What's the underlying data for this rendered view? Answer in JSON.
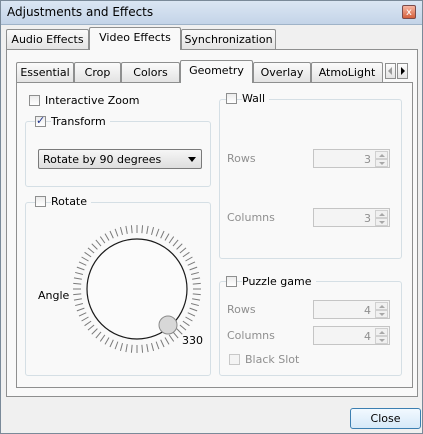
{
  "window": {
    "title": "Adjustments and Effects",
    "close_glyph": "x"
  },
  "main_tabs": [
    "Audio Effects",
    "Video Effects",
    "Synchronization"
  ],
  "sub_tabs": [
    "Essential",
    "Crop",
    "Colors",
    "Geometry",
    "Overlay",
    "AtmoLight"
  ],
  "geometry": {
    "interactive_zoom": {
      "label": "Interactive Zoom",
      "checked": false
    },
    "transform": {
      "label": "Transform",
      "checked": true,
      "selected": "Rotate by 90 degrees"
    },
    "rotate": {
      "label": "Rotate",
      "checked": false,
      "angle_label": "Angle",
      "value": 330
    },
    "wall": {
      "label": "Wall",
      "checked": false,
      "rows_label": "Rows",
      "rows": "3",
      "columns_label": "Columns",
      "columns": "3"
    },
    "puzzle": {
      "label": "Puzzle game",
      "checked": false,
      "rows_label": "Rows",
      "rows": "4",
      "columns_label": "Columns",
      "columns": "4",
      "black_slot_label": "Black Slot"
    }
  },
  "footer": {
    "close_label": "Close"
  },
  "colors": {
    "accent": "#21358c",
    "button_border": "#3c7fb1"
  }
}
